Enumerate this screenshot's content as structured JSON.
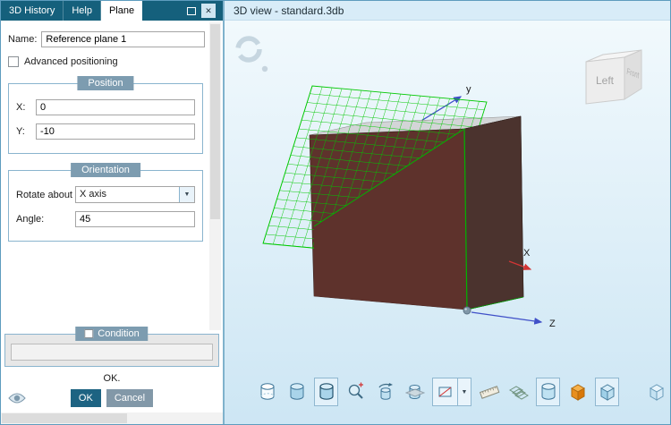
{
  "window": {
    "icons": {
      "close_glyph": "✕",
      "caret_down_glyph": "▼",
      "overflow_glyph": "»"
    }
  },
  "left_panel": {
    "tabs": [
      {
        "label": "3D History",
        "active": false
      },
      {
        "label": "Help",
        "active": false
      },
      {
        "label": "Plane",
        "active": true
      }
    ],
    "name_field": {
      "label": "Name:",
      "value": "Reference plane 1"
    },
    "advanced_checkbox": {
      "label": "Advanced positioning",
      "checked": false
    },
    "position_group": {
      "title": "Position",
      "x": {
        "label": "X:",
        "value": "0"
      },
      "y": {
        "label": "Y:",
        "value": "-10"
      }
    },
    "orientation_group": {
      "title": "Orientation",
      "rotate_about": {
        "label": "Rotate about",
        "value": "X axis"
      },
      "angle": {
        "label": "Angle:",
        "value": "45"
      }
    },
    "condition_group": {
      "title": "Condition",
      "checked": false,
      "value": ""
    },
    "status_text": "OK.",
    "buttons": {
      "ok": "OK",
      "cancel": "Cancel"
    }
  },
  "viewport": {
    "title": "3D view - standard.3db",
    "axes": {
      "x": "X",
      "y": "y",
      "z": "Z"
    },
    "nav_cube": {
      "left_face": "Left",
      "front_face": "Front"
    },
    "colors": {
      "cube_front": "#5e322c",
      "cube_side": "#4b332e",
      "cube_top": "#d3d5d7",
      "plane_grid": "#00c800",
      "axis_blue": "#4050c8",
      "axis_red": "#d23535",
      "accent_teal": "#15607c"
    }
  },
  "toolbar": {
    "items": [
      {
        "name": "view-hidden-line-cylinder"
      },
      {
        "name": "view-shaded-cylinder"
      },
      {
        "name": "view-shaded-edges-cylinder",
        "selected": true
      },
      {
        "name": "zoom-magnifier"
      },
      {
        "name": "view-rotate-cylinder"
      },
      {
        "name": "section-view-cylinder"
      },
      {
        "name": "view-mode-combo",
        "selected": true
      },
      {
        "name": "measure-ruler"
      },
      {
        "name": "hatch-grid"
      },
      {
        "name": "render-quality-cylinder",
        "selected": true
      },
      {
        "name": "solid-model-cube"
      },
      {
        "name": "active-part-cube",
        "selected": true
      },
      {
        "name": "new-part-cube"
      },
      {
        "name": "toolbar-overflow"
      }
    ]
  }
}
